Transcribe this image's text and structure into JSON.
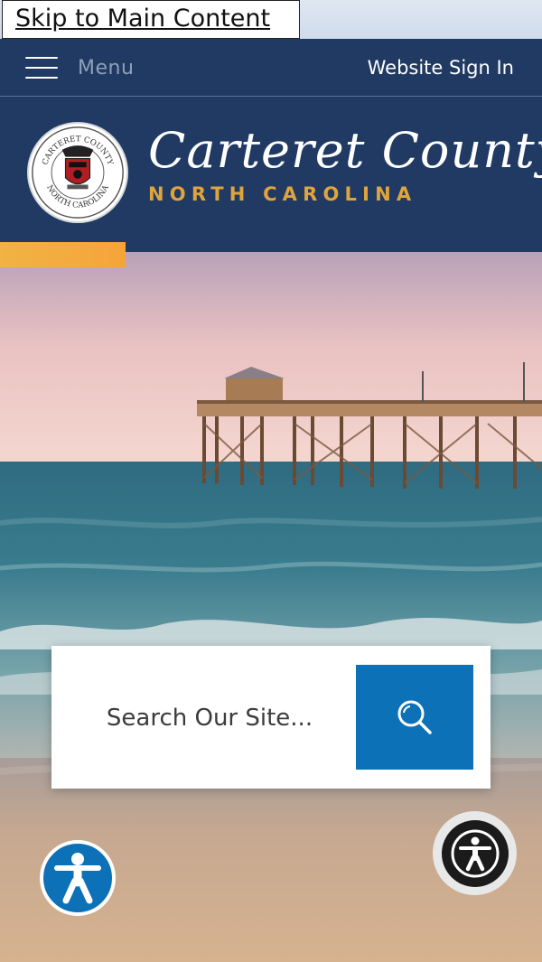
{
  "skip_link": {
    "label": "Skip to Main Content"
  },
  "topbar": {
    "menu_label": "Menu",
    "signin_label": "Website Sign In"
  },
  "header": {
    "county_name": "Carteret County",
    "state_name": "NORTH CAROLINA",
    "seal_text_top": "CARTERET COUNTY",
    "seal_text_bottom": "NORTH CAROLINA"
  },
  "search": {
    "placeholder": "Search Our Site..."
  },
  "icons": {
    "menu": "hamburger-icon",
    "search": "search-icon",
    "accessibility_left": "accessibility-icon",
    "accessibility_right": "accessibility-icon"
  },
  "colors": {
    "navy": "#203a63",
    "gold": "#e0a43c",
    "blue": "#0d71b7"
  }
}
